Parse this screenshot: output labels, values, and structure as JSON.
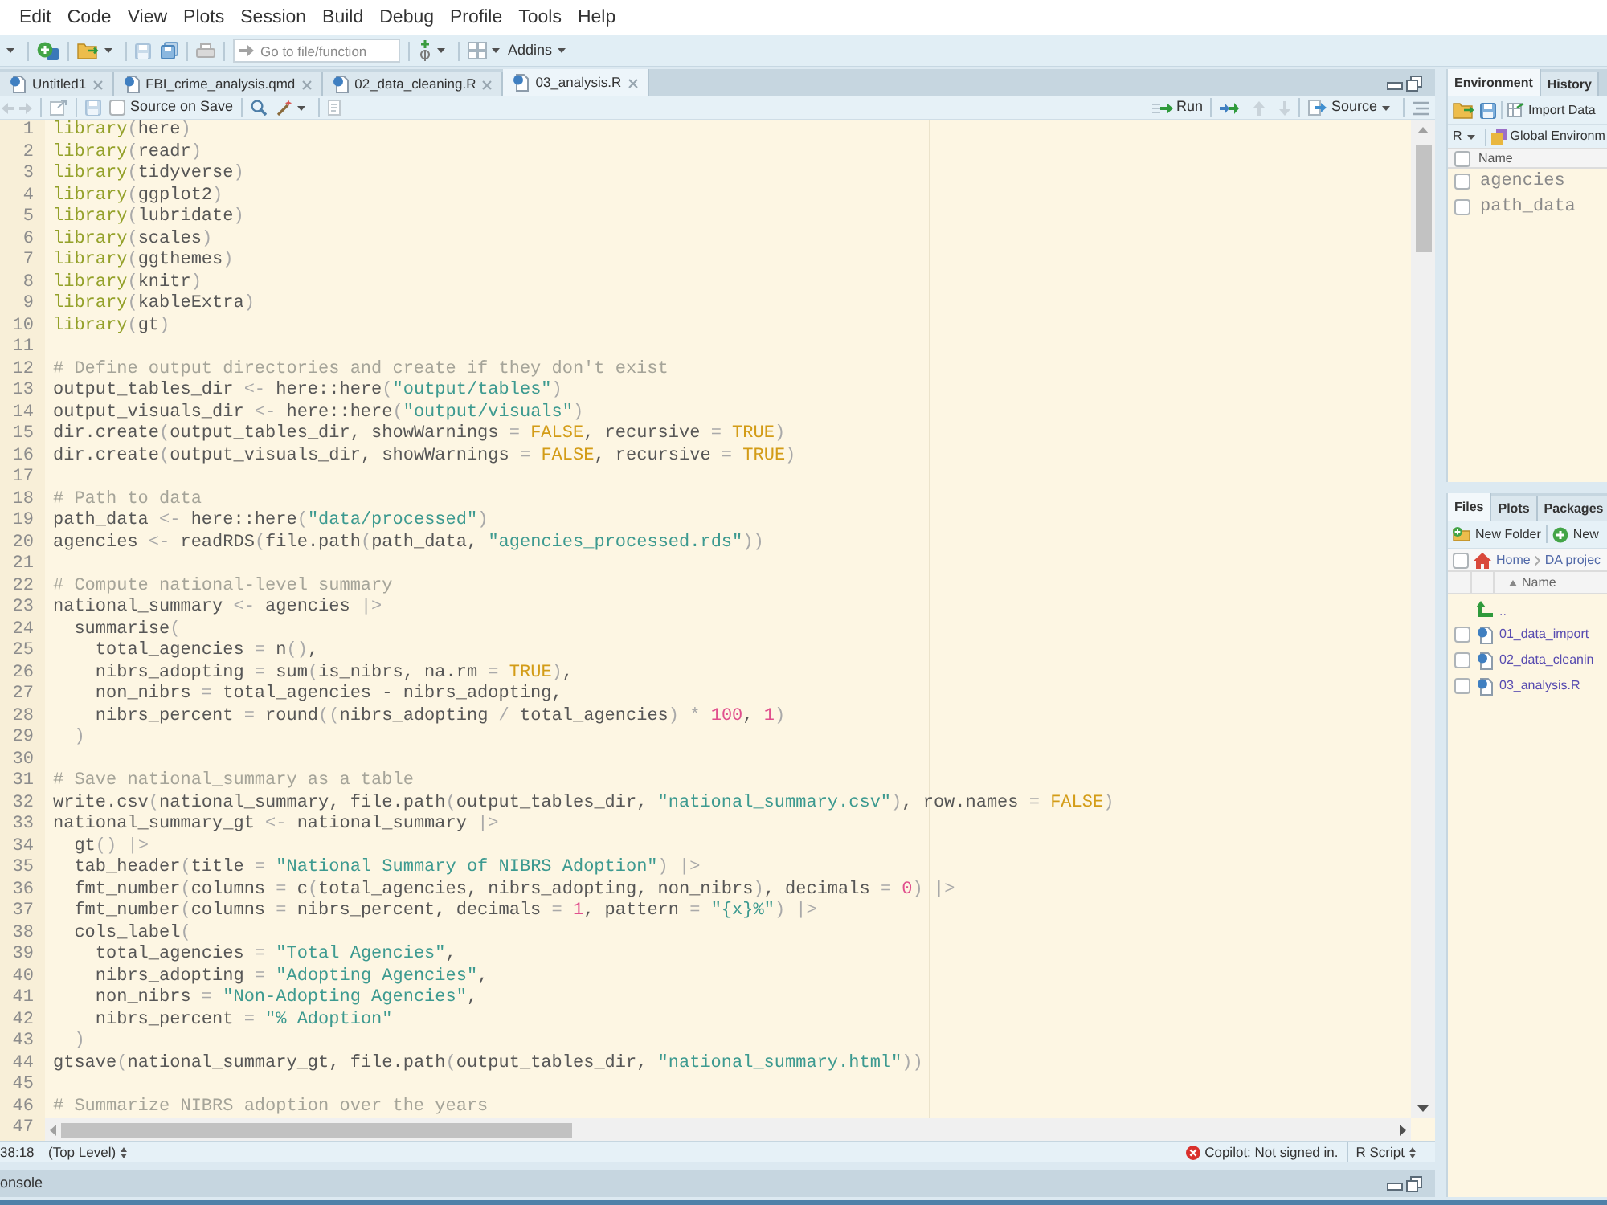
{
  "menu_bar": {
    "items": [
      "Edit",
      "Code",
      "View",
      "Plots",
      "Session",
      "Build",
      "Debug",
      "Profile",
      "Tools",
      "Help"
    ]
  },
  "toolbar": {
    "go_to_file": {
      "placeholder": "Go to file/function"
    },
    "addins": "Addins"
  },
  "editor": {
    "tabs": [
      {
        "label": "Untitled1",
        "selected": false
      },
      {
        "label": "FBI_crime_analysis.qmd",
        "selected": false
      },
      {
        "label": "02_data_cleaning.R",
        "selected": false
      },
      {
        "label": "03_analysis.R",
        "selected": true
      }
    ],
    "toolbar": {
      "source_on_save": {
        "label": "Source on Save",
        "checked": false
      },
      "run": "Run",
      "source": "Source"
    },
    "lines": [
      {
        "number": "1",
        "tokens": [
          {
            "text": "library",
            "kind": "keyword"
          },
          {
            "text": "(here)",
            "kind": "plain"
          }
        ]
      },
      {
        "number": "2",
        "tokens": [
          {
            "text": "library",
            "kind": "keyword"
          },
          {
            "text": "(readr)",
            "kind": "plain"
          }
        ]
      },
      {
        "number": "3",
        "tokens": [
          {
            "text": "library",
            "kind": "keyword"
          },
          {
            "text": "(tidyverse)",
            "kind": "plain"
          }
        ]
      },
      {
        "number": "4",
        "tokens": [
          {
            "text": "library",
            "kind": "keyword"
          },
          {
            "text": "(ggplot2)",
            "kind": "plain"
          }
        ]
      },
      {
        "number": "5",
        "tokens": [
          {
            "text": "library",
            "kind": "keyword"
          },
          {
            "text": "(lubridate)",
            "kind": "plain"
          }
        ]
      },
      {
        "number": "6",
        "tokens": [
          {
            "text": "library",
            "kind": "keyword"
          },
          {
            "text": "(scales)",
            "kind": "plain"
          }
        ]
      },
      {
        "number": "7",
        "tokens": [
          {
            "text": "library",
            "kind": "keyword"
          },
          {
            "text": "(ggthemes)",
            "kind": "plain"
          }
        ]
      },
      {
        "number": "8",
        "tokens": [
          {
            "text": "library",
            "kind": "keyword"
          },
          {
            "text": "(knitr)",
            "kind": "plain"
          }
        ]
      },
      {
        "number": "9",
        "tokens": [
          {
            "text": "library",
            "kind": "keyword"
          },
          {
            "text": "(kableExtra)",
            "kind": "plain"
          }
        ]
      },
      {
        "number": "10",
        "tokens": [
          {
            "text": "library",
            "kind": "keyword"
          },
          {
            "text": "(gt)",
            "kind": "plain"
          }
        ]
      },
      {
        "number": "11"
      },
      {
        "number": "12",
        "tokens": [
          {
            "text": "# Define output directories and create if they don't exist",
            "kind": "comment"
          }
        ]
      },
      {
        "number": "13",
        "tokens": [
          {
            "text": "output_tables_dir <- here::here(",
            "kind": "plain"
          },
          {
            "text": "\"output/tables\"",
            "kind": "string"
          },
          {
            "text": ")",
            "kind": "plain"
          }
        ]
      },
      {
        "number": "14",
        "tokens": [
          {
            "text": "output_visuals_dir <- here::here(",
            "kind": "plain"
          },
          {
            "text": "\"output/visuals\"",
            "kind": "string"
          },
          {
            "text": ")",
            "kind": "plain"
          }
        ]
      },
      {
        "number": "15",
        "tokens": [
          {
            "text": "dir.create(output_tables_dir, showWarnings = ",
            "kind": "plain"
          },
          {
            "text": "FALSE",
            "kind": "constant"
          },
          {
            "text": ", recursive = ",
            "kind": "plain"
          },
          {
            "text": "TRUE",
            "kind": "constant"
          },
          {
            "text": ")",
            "kind": "plain"
          }
        ]
      },
      {
        "number": "16",
        "tokens": [
          {
            "text": "dir.create(output_visuals_dir, showWarnings = ",
            "kind": "plain"
          },
          {
            "text": "FALSE",
            "kind": "constant"
          },
          {
            "text": ", recursive = ",
            "kind": "plain"
          },
          {
            "text": "TRUE",
            "kind": "constant"
          },
          {
            "text": ")",
            "kind": "plain"
          }
        ]
      },
      {
        "number": "17"
      },
      {
        "number": "18",
        "tokens": [
          {
            "text": "# Path to data",
            "kind": "comment"
          }
        ]
      },
      {
        "number": "19",
        "tokens": [
          {
            "text": "path_data <- here::here(",
            "kind": "plain"
          },
          {
            "text": "\"data/processed\"",
            "kind": "string"
          },
          {
            "text": ")",
            "kind": "plain"
          }
        ]
      },
      {
        "number": "20",
        "tokens": [
          {
            "text": "agencies <- readRDS(file.path(path_data, ",
            "kind": "plain"
          },
          {
            "text": "\"agencies_processed.rds\"",
            "kind": "string"
          },
          {
            "text": "))",
            "kind": "plain"
          }
        ]
      },
      {
        "number": "21"
      },
      {
        "number": "22",
        "tokens": [
          {
            "text": "# Compute national-level summary",
            "kind": "comment"
          }
        ]
      },
      {
        "number": "23",
        "tokens": [
          {
            "text": "national_summary <- agencies |>",
            "kind": "plain"
          }
        ]
      },
      {
        "number": "24",
        "tokens": [
          {
            "text": "  summarise(",
            "kind": "plain"
          }
        ]
      },
      {
        "number": "25",
        "tokens": [
          {
            "text": "    total_agencies = n(),",
            "kind": "plain"
          }
        ]
      },
      {
        "number": "26",
        "tokens": [
          {
            "text": "    nibrs_adopting = sum(is_nibrs, na.rm = ",
            "kind": "plain"
          },
          {
            "text": "TRUE",
            "kind": "constant"
          },
          {
            "text": "),",
            "kind": "plain"
          }
        ]
      },
      {
        "number": "27",
        "tokens": [
          {
            "text": "    non_nibrs = total_agencies - nibrs_adopting,",
            "kind": "plain"
          }
        ]
      },
      {
        "number": "28",
        "tokens": [
          {
            "text": "    nibrs_percent = round((nibrs_adopting / total_agencies) * ",
            "kind": "plain"
          },
          {
            "text": "100",
            "kind": "number"
          },
          {
            "text": ", ",
            "kind": "plain"
          },
          {
            "text": "1",
            "kind": "number"
          },
          {
            "text": ")",
            "kind": "plain"
          }
        ]
      },
      {
        "number": "29",
        "tokens": [
          {
            "text": "  )",
            "kind": "plain"
          }
        ]
      },
      {
        "number": "30"
      },
      {
        "number": "31",
        "tokens": [
          {
            "text": "# Save national_summary as a table",
            "kind": "comment"
          }
        ]
      },
      {
        "number": "32",
        "tokens": [
          {
            "text": "write.csv(national_summary, file.path(output_tables_dir, ",
            "kind": "plain"
          },
          {
            "text": "\"national_summary.csv\"",
            "kind": "string"
          },
          {
            "text": "), row.names = ",
            "kind": "plain"
          },
          {
            "text": "FALSE",
            "kind": "constant"
          },
          {
            "text": ")",
            "kind": "plain"
          }
        ]
      },
      {
        "number": "33",
        "tokens": [
          {
            "text": "national_summary_gt <- national_summary |>",
            "kind": "plain"
          }
        ]
      },
      {
        "number": "34",
        "tokens": [
          {
            "text": "  gt() |>",
            "kind": "plain"
          }
        ]
      },
      {
        "number": "35",
        "tokens": [
          {
            "text": "  tab_header(title = ",
            "kind": "plain"
          },
          {
            "text": "\"National Summary of NIBRS Adoption\"",
            "kind": "string"
          },
          {
            "text": ") |>",
            "kind": "plain"
          }
        ]
      },
      {
        "number": "36",
        "tokens": [
          {
            "text": "  fmt_number(columns = c(total_agencies, nibrs_adopting, non_nibrs), decimals = ",
            "kind": "plain"
          },
          {
            "text": "0",
            "kind": "number"
          },
          {
            "text": ") |>",
            "kind": "plain"
          }
        ]
      },
      {
        "number": "37",
        "tokens": [
          {
            "text": "  fmt_number(columns = nibrs_percent, decimals = ",
            "kind": "plain"
          },
          {
            "text": "1",
            "kind": "number"
          },
          {
            "text": ", pattern = ",
            "kind": "plain"
          },
          {
            "text": "\"{x}%\"",
            "kind": "string"
          },
          {
            "text": ") |>",
            "kind": "plain"
          }
        ]
      },
      {
        "number": "38",
        "tokens": [
          {
            "text": "  cols_label(",
            "kind": "plain"
          }
        ]
      },
      {
        "number": "39",
        "tokens": [
          {
            "text": "    total_agencies = ",
            "kind": "plain"
          },
          {
            "text": "\"Total Agencies\"",
            "kind": "string"
          },
          {
            "text": ",",
            "kind": "plain"
          }
        ]
      },
      {
        "number": "40",
        "tokens": [
          {
            "text": "    nibrs_adopting = ",
            "kind": "plain"
          },
          {
            "text": "\"Adopting Agencies\"",
            "kind": "string"
          },
          {
            "text": ",",
            "kind": "plain"
          }
        ]
      },
      {
        "number": "41",
        "tokens": [
          {
            "text": "    non_nibrs = ",
            "kind": "plain"
          },
          {
            "text": "\"Non-Adopting Agencies\"",
            "kind": "string"
          },
          {
            "text": ",",
            "kind": "plain"
          }
        ]
      },
      {
        "number": "42",
        "tokens": [
          {
            "text": "    nibrs_percent = ",
            "kind": "plain"
          },
          {
            "text": "\"% Adoption\"",
            "kind": "string"
          }
        ]
      },
      {
        "number": "43",
        "tokens": [
          {
            "text": "  )",
            "kind": "plain"
          }
        ]
      },
      {
        "number": "44",
        "tokens": [
          {
            "text": "gtsave(national_summary_gt, file.path(output_tables_dir, ",
            "kind": "plain"
          },
          {
            "text": "\"national_summary.html\"",
            "kind": "string"
          },
          {
            "text": "))",
            "kind": "plain"
          }
        ]
      },
      {
        "number": "45"
      },
      {
        "number": "46",
        "tokens": [
          {
            "text": "# Summarize NIBRS adoption over the years",
            "kind": "comment"
          }
        ]
      },
      {
        "number": "47"
      }
    ],
    "status_bar": {
      "cursor": "38:18",
      "scope": "(Top Level)",
      "copilot": "Copilot: Not signed in.",
      "file_type": "R Script"
    }
  },
  "console": {
    "title": "onsole"
  },
  "environment": {
    "tabs": [
      {
        "label": "Environment",
        "selected": true
      },
      {
        "label": "History",
        "selected": false
      }
    ],
    "import_data": "Import Data",
    "language": "R",
    "scope": "Global Environm",
    "select_all": {
      "checked": false
    },
    "column": "Name",
    "rows": [
      {
        "name": "agencies",
        "checked": false
      },
      {
        "name": "path_data",
        "checked": false
      }
    ]
  },
  "files": {
    "tabs": [
      {
        "label": "Files",
        "selected": true
      },
      {
        "label": "Plots",
        "selected": false
      },
      {
        "label": "Packages",
        "selected": false
      }
    ],
    "new_folder": "New Folder",
    "new_file": "New",
    "select_all": {
      "checked": false
    },
    "breadcrumb": [
      "Home",
      "DA projec"
    ],
    "column": "Name",
    "parent": "..",
    "rows": [
      {
        "name": "01_data_import",
        "checked": false
      },
      {
        "name": "02_data_cleanin",
        "checked": false
      },
      {
        "name": "03_analysis.R",
        "checked": false
      }
    ]
  }
}
